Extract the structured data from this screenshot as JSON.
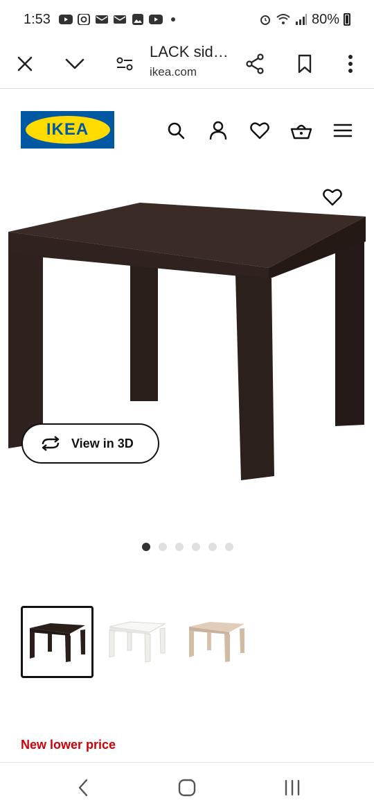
{
  "status_bar": {
    "time": "1:53",
    "battery": "80%"
  },
  "browser": {
    "page_title": "LACK sid…",
    "domain": "ikea.com"
  },
  "ikea": {
    "logo_text": "IKEA",
    "brand_blue": "#0058a3",
    "brand_yellow": "#ffdb00"
  },
  "product": {
    "view_3d_label": "View in 3D",
    "carousel": {
      "count": 6,
      "active_index": 0
    },
    "variants": [
      {
        "color_name": "black-brown",
        "color": "#2b1f1c",
        "selected": true
      },
      {
        "color_name": "white",
        "color": "#f4f4f2",
        "selected": false
      },
      {
        "color_name": "white stained oak effect",
        "color": "#d9c3b0",
        "selected": false
      }
    ],
    "price_note": "New lower price",
    "price_note_color": "#cc0008"
  }
}
